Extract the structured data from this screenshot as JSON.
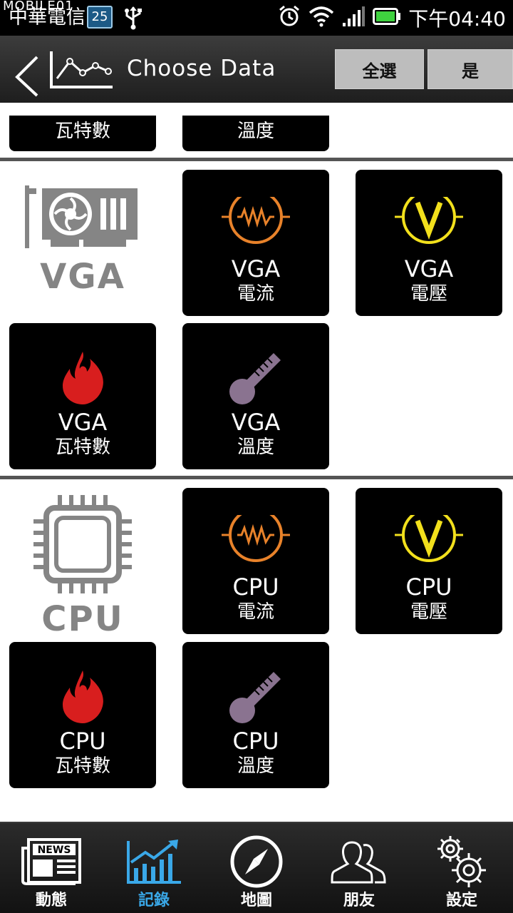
{
  "status_bar": {
    "watermark": "MOBILE01",
    "carrier": "中華電信",
    "calendar_day": "25",
    "time": "下午04:40",
    "icons": [
      "usb-icon",
      "alarm-icon",
      "wifi-icon",
      "signal-icon",
      "battery-icon"
    ]
  },
  "header": {
    "title": "Choose Data",
    "select_all_label": "全選",
    "confirm_label": "是"
  },
  "partial_row": [
    {
      "line2": "瓦特數"
    },
    {
      "line2": "溫度"
    }
  ],
  "sections": [
    {
      "category": "VGA",
      "category_icon": "graphics-card-icon",
      "items": [
        {
          "line1": "VGA",
          "line2": "電流",
          "icon": "current-icon",
          "color": "#e8822a"
        },
        {
          "line1": "VGA",
          "line2": "電壓",
          "icon": "voltage-icon",
          "color": "#f2e01c"
        },
        {
          "line1": "VGA",
          "line2": "瓦特數",
          "icon": "fire-icon",
          "color": "#d81e1e"
        },
        {
          "line1": "VGA",
          "line2": "溫度",
          "icon": "thermometer-icon",
          "color": "#8a7390"
        }
      ]
    },
    {
      "category": "CPU",
      "category_icon": "cpu-chip-icon",
      "items": [
        {
          "line1": "CPU",
          "line2": "電流",
          "icon": "current-icon",
          "color": "#e8822a"
        },
        {
          "line1": "CPU",
          "line2": "電壓",
          "icon": "voltage-icon",
          "color": "#f2e01c"
        },
        {
          "line1": "CPU",
          "line2": "瓦特數",
          "icon": "fire-icon",
          "color": "#d81e1e"
        },
        {
          "line1": "CPU",
          "line2": "溫度",
          "icon": "thermometer-icon",
          "color": "#8a7390"
        }
      ]
    }
  ],
  "bottom_nav": [
    {
      "label": "動態",
      "icon": "news-icon",
      "active": false
    },
    {
      "label": "記錄",
      "icon": "chart-icon",
      "active": true
    },
    {
      "label": "地圖",
      "icon": "compass-icon",
      "active": false
    },
    {
      "label": "朋友",
      "icon": "friends-icon",
      "active": false
    },
    {
      "label": "設定",
      "icon": "gear-icon",
      "active": false
    }
  ],
  "colors": {
    "active_tab": "#3aa8e8",
    "category_gray": "#858585"
  }
}
